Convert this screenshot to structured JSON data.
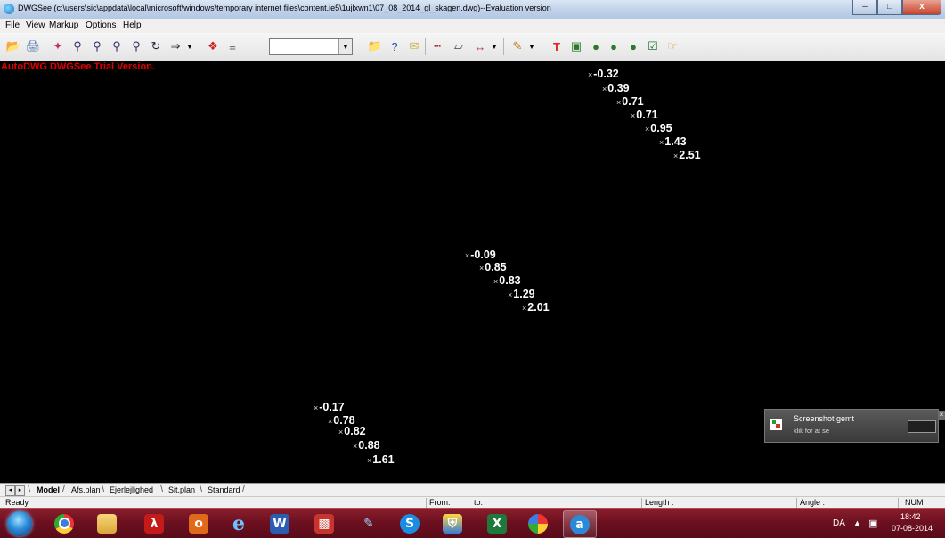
{
  "window": {
    "title": "DWGSee (c:\\users\\sic\\appdata\\local\\microsoft\\windows\\temporary internet files\\content.ie5\\1ujlxwn1\\07_08_2014_gl_skagen.dwg)--Evaluation version",
    "minimize": "–",
    "maximize": "□",
    "close": "x"
  },
  "menu": [
    "File",
    "View",
    "Markup",
    "Options",
    "Help"
  ],
  "toolbar": {
    "icons": [
      "open-folder-icon",
      "print-icon",
      "pan-icon",
      "zoom-in-icon",
      "zoom-out-icon",
      "zoom-window-icon",
      "zoom-extents-icon",
      "rotate-icon",
      "next-arrow-icon",
      "dropdown-arrow-icon",
      "layer-icon",
      "layers-stack-icon"
    ],
    "layer_dropdown_value": "",
    "right_icons": [
      "open-file-icon",
      "help-icon",
      "email-icon",
      "measure-icon",
      "area-icon",
      "dimension-icon",
      "dropdown-arrow-icon",
      "pen-icon",
      "dropdown-arrow-icon",
      "text-icon",
      "comment-icon",
      "cloud-comment-icon",
      "bubble-icon",
      "callout-icon",
      "stamp-icon",
      "hand-wizard-icon"
    ]
  },
  "canvas": {
    "watermark": "AutoDWG DWGSee Trial Version.",
    "groups": [
      {
        "labels": [
          "-0.32",
          "0.39",
          "0.71",
          "0.71",
          "0.95",
          "1.43",
          "2.51"
        ]
      },
      {
        "labels": [
          "-0.09",
          "0.85",
          "0.83",
          "1.29",
          "2.01"
        ]
      },
      {
        "labels": [
          "-0.17",
          "0.78",
          "0.82",
          "0.88",
          "1.61"
        ]
      }
    ]
  },
  "notification": {
    "title": "Screenshot gemt",
    "subtitle": "klik for at se",
    "close": "×"
  },
  "tabs": {
    "nav_prev": "◂",
    "nav_next": "▸",
    "items": [
      "Model",
      "Afs.plan",
      "Ejerlejlighed",
      "Sit.plan",
      "Standard"
    ],
    "active": "Model"
  },
  "status": {
    "ready": "Ready",
    "from": "From:",
    "to": "to:",
    "length": "Length :",
    "angle": "Angle :",
    "num": "NUM"
  },
  "taskbar": {
    "apps": [
      {
        "name": "chrome",
        "open": false
      },
      {
        "name": "explorer",
        "open": false
      },
      {
        "name": "acrobat",
        "open": false
      },
      {
        "name": "outlook",
        "open": false
      },
      {
        "name": "internet-explorer",
        "open": false
      },
      {
        "name": "word",
        "open": false
      },
      {
        "name": "remote-app",
        "open": false
      },
      {
        "name": "paint-tool",
        "open": false
      },
      {
        "name": "skype",
        "open": false
      },
      {
        "name": "security",
        "open": false
      },
      {
        "name": "excel",
        "open": false
      },
      {
        "name": "picasa",
        "open": false
      },
      {
        "name": "dwgsee",
        "open": true
      }
    ],
    "language": "DA",
    "tray_arrow": "▲",
    "time": "18:42",
    "date": "07-08-2014"
  }
}
